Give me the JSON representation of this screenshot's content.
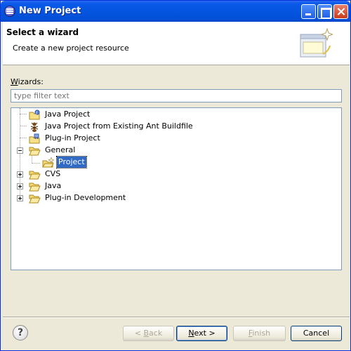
{
  "window": {
    "title": "New Project"
  },
  "header": {
    "title": "Select a wizard",
    "description": "Create a new project resource"
  },
  "wizards": {
    "label_prefix": "",
    "label_mnemonic": "W",
    "label_rest": "izards:",
    "filter_placeholder": "type filter text"
  },
  "tree": {
    "items": [
      {
        "label": "Java Project",
        "icon": "java-project-icon"
      },
      {
        "label": "Java Project from Existing Ant Buildfile",
        "icon": "ant-icon"
      },
      {
        "label": "Plug-in Project",
        "icon": "plugin-project-icon"
      },
      {
        "label": "General",
        "icon": "folder-open-icon",
        "expanded": true
      },
      {
        "label": "Project",
        "icon": "project-icon",
        "selected": true
      },
      {
        "label": "CVS",
        "icon": "folder-icon",
        "expanded": false
      },
      {
        "label": "Java",
        "icon": "folder-icon",
        "expanded": false
      },
      {
        "label": "Plug-in Development",
        "icon": "folder-icon",
        "expanded": false
      }
    ]
  },
  "footer": {
    "help_icon": "?",
    "back_prefix": "< ",
    "back_mnemonic": "B",
    "back_rest": "ack",
    "next_mnemonic": "N",
    "next_rest": "ext >",
    "finish_mnemonic": "F",
    "finish_rest": "inish",
    "cancel_label": "Cancel"
  }
}
